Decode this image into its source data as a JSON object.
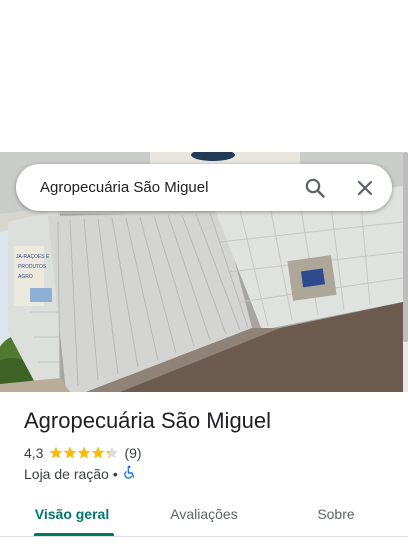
{
  "search": {
    "query": "Agropecuária São Miguel"
  },
  "place": {
    "name": "Agropecuária São Miguel",
    "rating": "4,3",
    "stars": 4.3,
    "reviews": "(9)",
    "category": "Loja de ração",
    "separator": "•",
    "accessibility_icon": "wheelchair-accessible-icon"
  },
  "tabs": [
    {
      "label": "Visão geral",
      "active": true
    },
    {
      "label": "Avaliações",
      "active": false
    },
    {
      "label": "Sobre",
      "active": false
    }
  ],
  "colors": {
    "accent": "#00796b",
    "star": "#fbbc04",
    "accessibility": "#1a73e8",
    "text": "#202124",
    "secondary_text": "#3c4043",
    "tab_text": "#5f6368"
  }
}
